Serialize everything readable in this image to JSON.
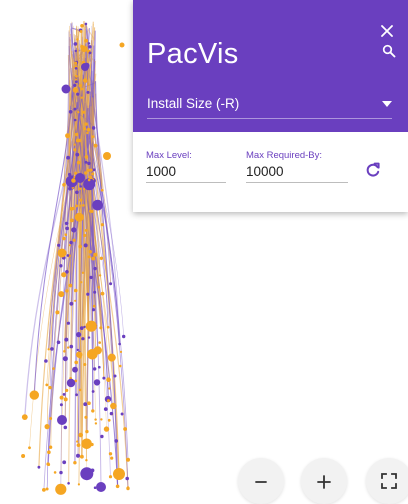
{
  "app": {
    "title": "PacVis"
  },
  "header": {
    "close_icon": "close-icon",
    "search_icon": "search-icon",
    "sort_select": {
      "value": "Install Size (-R)",
      "icon": "dropdown-caret-icon"
    }
  },
  "filters": {
    "max_level_label": "Max Level:",
    "max_level_value": "1000",
    "max_required_by_label": "Max Required-By:",
    "max_required_by_value": "10000",
    "refresh_icon": "refresh-icon"
  },
  "zoom_controls": {
    "zoom_out_icon": "minus-icon",
    "zoom_in_icon": "plus-icon",
    "fullscreen_icon": "fullscreen-icon"
  },
  "colors": {
    "primary": "#6a3fbf",
    "node_orange": "#f5a623",
    "node_purple": "#6a3fbf",
    "edge_orange": "#e8a94a",
    "edge_purple": "#7a59c9",
    "fab_background": "#f2f2f2"
  }
}
